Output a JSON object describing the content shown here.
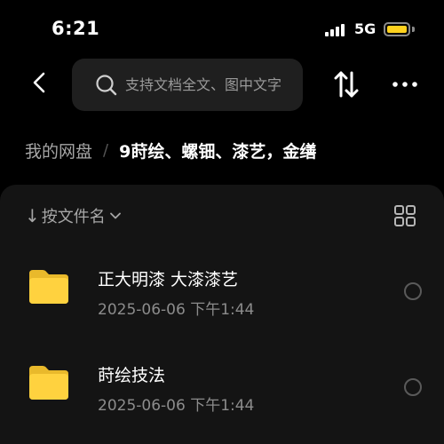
{
  "status_bar": {
    "time": "6:21",
    "network": "5G",
    "battery_level": 1.0,
    "battery_color": "#ffd21e"
  },
  "nav": {
    "back_icon": "chevron-left-icon",
    "search_placeholder": "支持文档全文、图中文字",
    "search_icon": "search-icon",
    "sort_icon": "sort-arrows-icon",
    "more_icon": "more-dots-icon"
  },
  "breadcrumb": {
    "root": "我的网盘",
    "separator": "/",
    "current": "9莳绘、螺钿、漆艺，金缮"
  },
  "list_header": {
    "sort_label": "按文件名",
    "sort_arrow": "↓",
    "view_toggle_icon": "grid-view-icon"
  },
  "files": [
    {
      "name": "正大明漆 大漆漆艺",
      "meta": "2025-06-06 下午1:44",
      "icon": "folder-icon"
    },
    {
      "name": "莳绘技法",
      "meta": "2025-06-06 下午1:44",
      "icon": "folder-icon"
    }
  ],
  "colors": {
    "background": "#000000",
    "panel": "#141414",
    "search_bg": "#1f1f1f",
    "folder": "#ffd23f",
    "secondary_text": "#8c8c8c"
  }
}
